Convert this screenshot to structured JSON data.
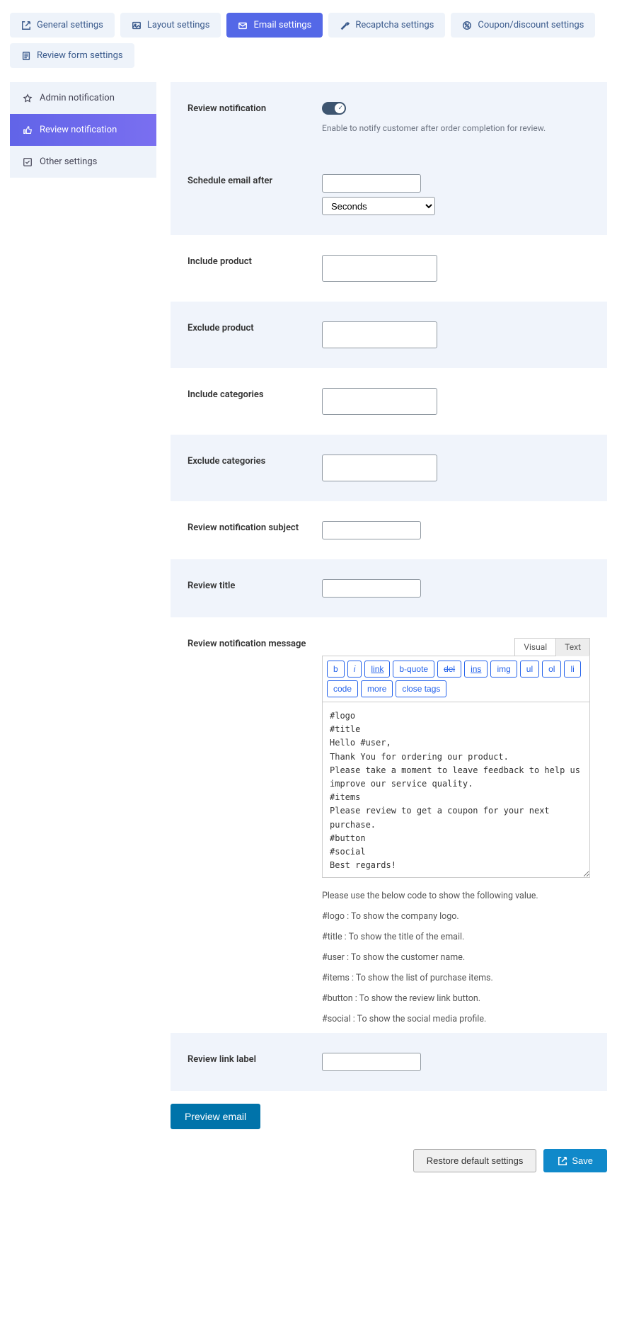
{
  "tabs": {
    "general": "General settings",
    "layout": "Layout settings",
    "email": "Email settings",
    "recaptcha": "Recaptcha settings",
    "coupon": "Coupon/discount settings",
    "reviewform": "Review form settings"
  },
  "sidebar": {
    "admin_notif": "Admin notification",
    "review_notif": "Review notification",
    "other": "Other settings"
  },
  "form": {
    "review_notification": {
      "label": "Review notification",
      "enabled": true,
      "desc": "Enable to notify customer after order completion for review."
    },
    "schedule": {
      "label": "Schedule email after",
      "value": "",
      "unit_selected": "Seconds"
    },
    "include_product": {
      "label": "Include product"
    },
    "exclude_product": {
      "label": "Exclude product"
    },
    "include_categories": {
      "label": "Include categories"
    },
    "exclude_categories": {
      "label": "Exclude categories"
    },
    "subject": {
      "label": "Review notification subject",
      "value": ""
    },
    "title": {
      "label": "Review title",
      "value": ""
    },
    "message": {
      "label": "Review notification message",
      "tab_visual": "Visual",
      "tab_text": "Text",
      "toolbar": {
        "b": "b",
        "i": "i",
        "link": "link",
        "bquote": "b-quote",
        "del": "del",
        "ins": "ins",
        "img": "img",
        "ul": "ul",
        "ol": "ol",
        "li": "li",
        "code": "code",
        "more": "more",
        "close": "close tags"
      },
      "body": "#logo\n#title\nHello #user,\nThank You for ordering our product.\nPlease take a moment to leave feedback to help us improve our service quality.\n#items\nPlease review to get a coupon for your next purchase.\n#button\n#social\nBest regards!",
      "help_intro": "Please use the below code to show the following value.",
      "help_logo": "#logo : To show the company logo.",
      "help_title": "#title : To show the title of the email.",
      "help_user": "#user : To show the customer name.",
      "help_items": "#items : To show the list of purchase items.",
      "help_button": "#button : To show the review link button.",
      "help_social": "#social : To show the social media profile."
    },
    "link_label": {
      "label": "Review link label",
      "value": ""
    }
  },
  "actions": {
    "preview": "Preview email",
    "restore": "Restore default settings",
    "save": "Save"
  }
}
